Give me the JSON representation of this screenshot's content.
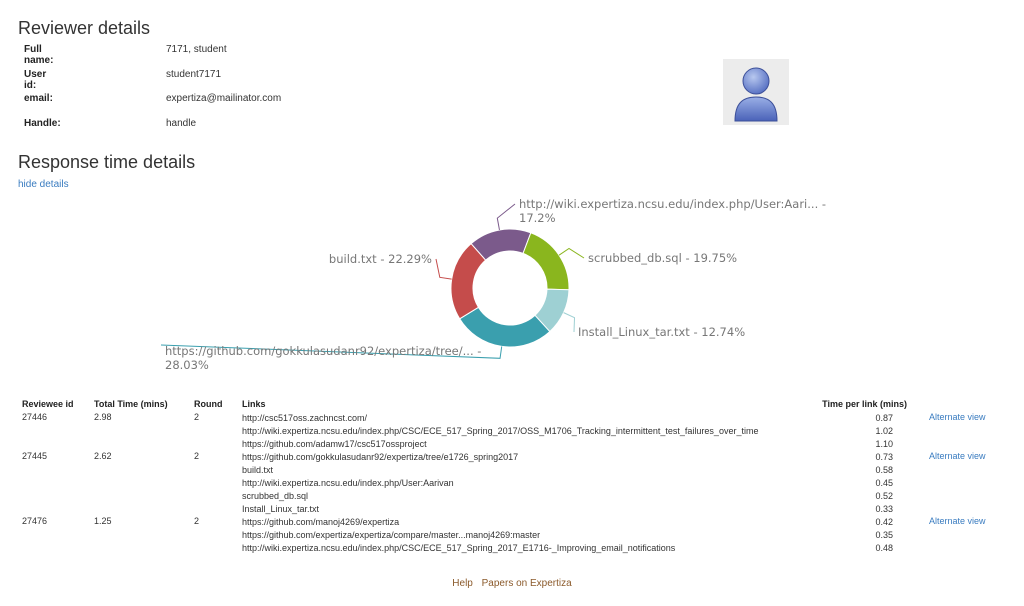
{
  "reviewer": {
    "title": "Reviewer details",
    "fields": [
      {
        "label": "Full name:",
        "value": "7171, student"
      },
      {
        "label": "User id:",
        "value": "student7171"
      },
      {
        "label": "email:",
        "value": "expertiza@mailinator.com"
      },
      {
        "label": "Handle:",
        "value": "handle"
      }
    ]
  },
  "response": {
    "title": "Response time details",
    "hide_link": "hide details"
  },
  "chart_data": {
    "type": "pie",
    "donut": true,
    "slices": [
      {
        "label": "http://wiki.expertiza.ncsu.edu/index.php/User:Aari... - 17.2%",
        "value": 17.2,
        "color": "#7b5a8b"
      },
      {
        "label": "scrubbed_db.sql - 19.75%",
        "value": 19.75,
        "color": "#8ab61e"
      },
      {
        "label": "Install_Linux_tar.txt - 12.74%",
        "value": 12.74,
        "color": "#9ed0d3"
      },
      {
        "label": "https://github.com/gokkulasudanr92/expertiza/tree/... - 28.03%",
        "value": 28.03,
        "color": "#3a9fae"
      },
      {
        "label": "build.txt - 22.29%",
        "value": 22.29,
        "color": "#c54c4b"
      }
    ]
  },
  "table": {
    "headers": {
      "reviewee": "Reviewee id",
      "total": "Total Time (mins)",
      "round": "Round",
      "links": "Links",
      "tpl": "Time per link (mins)"
    },
    "rows": [
      {
        "reviewee": "27446",
        "total": "2.98",
        "round": "2",
        "alt": "Alternate view",
        "links": [
          {
            "url": "http://csc517oss.zachncst.com/",
            "time": "0.87"
          },
          {
            "url": "http://wiki.expertiza.ncsu.edu/index.php/CSC/ECE_517_Spring_2017/OSS_M1706_Tracking_intermittent_test_failures_over_time",
            "time": "1.02"
          },
          {
            "url": "https://github.com/adamw17/csc517ossproject",
            "time": "1.10"
          }
        ]
      },
      {
        "reviewee": "27445",
        "total": "2.62",
        "round": "2",
        "alt": "Alternate view",
        "links": [
          {
            "url": "https://github.com/gokkulasudanr92/expertiza/tree/e1726_spring2017",
            "time": "0.73"
          },
          {
            "url": "build.txt",
            "time": "0.58"
          },
          {
            "url": "http://wiki.expertiza.ncsu.edu/index.php/User:Aarivan",
            "time": "0.45"
          },
          {
            "url": "scrubbed_db.sql",
            "time": "0.52"
          },
          {
            "url": "Install_Linux_tar.txt",
            "time": "0.33"
          }
        ]
      },
      {
        "reviewee": "27476",
        "total": "1.25",
        "round": "2",
        "alt": "Alternate view",
        "links": [
          {
            "url": "https://github.com/manoj4269/expertiza",
            "time": "0.42"
          },
          {
            "url": "https://github.com/expertiza/expertiza/compare/master...manoj4269:master",
            "time": "0.35"
          },
          {
            "url": "http://wiki.expertiza.ncsu.edu/index.php/CSC/ECE_517_Spring_2017_E1716-_Improving_email_notifications",
            "time": "0.48"
          }
        ]
      }
    ]
  },
  "footer": {
    "help": "Help",
    "papers": "Papers on Expertiza"
  }
}
